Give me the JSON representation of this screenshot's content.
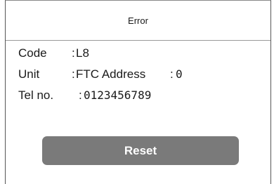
{
  "dialog": {
    "title": "Error"
  },
  "rows": {
    "code": {
      "label": "Code",
      "separator": ":",
      "value": "L8"
    },
    "unit": {
      "label": "Unit",
      "separator": ":",
      "value": "FTC Address",
      "sub_separator": ":",
      "sub_value": "0"
    },
    "tel": {
      "label": "Tel no.",
      "separator": ":",
      "value": "0123456789"
    }
  },
  "buttons": {
    "reset_label": "Reset"
  },
  "colors": {
    "button_bg": "#7a7a7a",
    "button_text": "#ffffff",
    "border": "#555555"
  }
}
